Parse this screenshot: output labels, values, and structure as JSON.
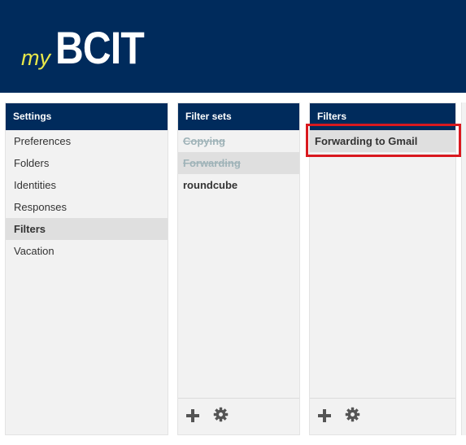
{
  "brand": {
    "my": "my",
    "name": "BCIT"
  },
  "settings": {
    "title": "Settings",
    "items": [
      {
        "label": "Preferences"
      },
      {
        "label": "Folders"
      },
      {
        "label": "Identities"
      },
      {
        "label": "Responses"
      },
      {
        "label": "Filters",
        "selected": true
      },
      {
        "label": "Vacation"
      }
    ]
  },
  "filter_sets": {
    "title": "Filter sets",
    "items": [
      {
        "label": "Copying",
        "state": "disabled"
      },
      {
        "label": "Forwarding",
        "state": "disabled",
        "selected": true
      },
      {
        "label": "roundcube",
        "state": "active"
      }
    ],
    "footer": {
      "add_icon": "plus-icon",
      "settings_icon": "gear-icon"
    }
  },
  "filters": {
    "title": "Filters",
    "items": [
      {
        "label": "Forwarding to Gmail",
        "selected": true
      }
    ],
    "footer": {
      "add_icon": "plus-icon",
      "settings_icon": "gear-icon"
    }
  },
  "colors": {
    "header_bg": "#002b5c",
    "logo_my": "#e8e84a",
    "highlight": "#d9191f",
    "selected_row": "#dfdfdf",
    "disabled_text": "#9fb3b8"
  }
}
